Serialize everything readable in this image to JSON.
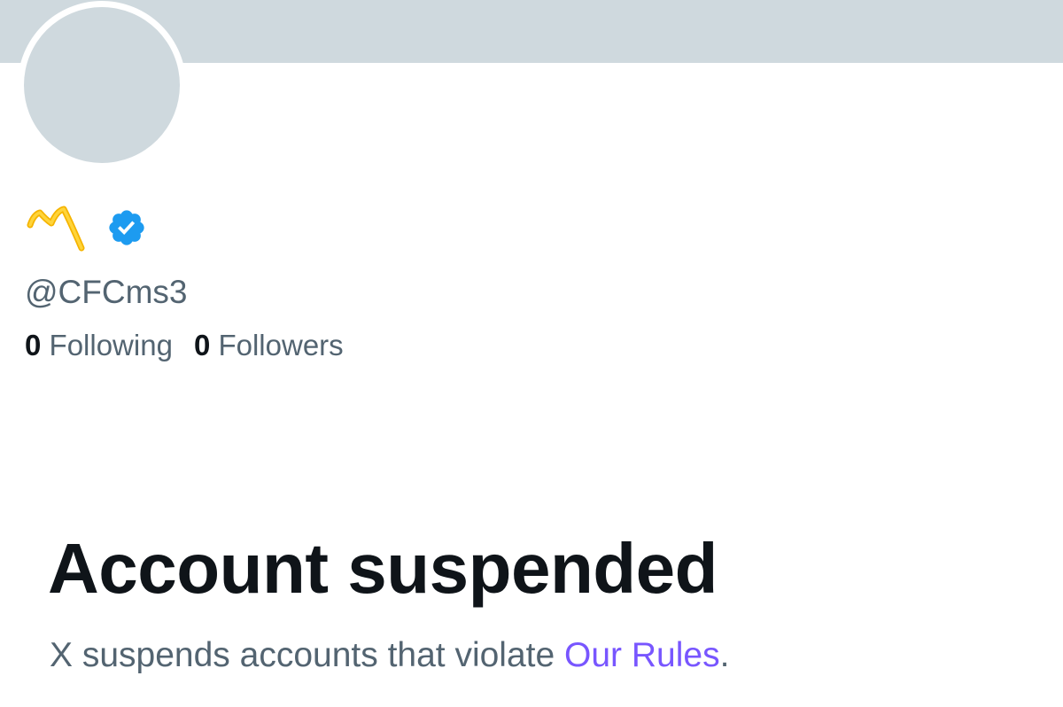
{
  "profile": {
    "handle": "@CFCms3",
    "verified": true,
    "verified_color": "#1d9bf0",
    "name_icon": "m-emoji-icon",
    "following_count": "0",
    "following_label": "Following",
    "followers_count": "0",
    "followers_label": "Followers"
  },
  "suspension": {
    "title": "Account suspended",
    "message_prefix": "X suspends accounts that violate ",
    "rules_link": "Our Rules",
    "message_suffix": "."
  },
  "colors": {
    "banner": "#cfd9de",
    "text_primary": "#0f1419",
    "text_secondary": "#536471",
    "link": "#7856ff"
  }
}
